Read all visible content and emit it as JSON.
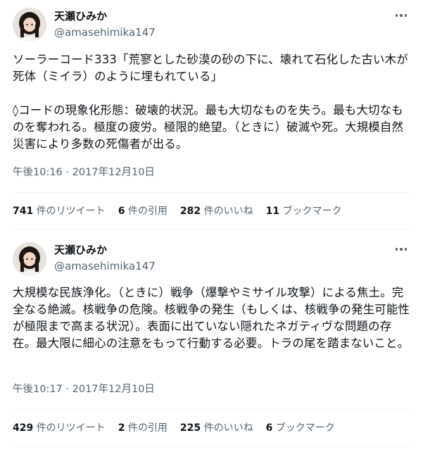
{
  "tweets": [
    {
      "author": {
        "name": "天瀬ひみか",
        "handle": "@amasehimika147"
      },
      "text": "ソーラーコード333「荒寥とした砂漠の砂の下に、壊れて石化した古い木が死体（ミイラ）のように埋もれている」\n\n◊コードの現象化形態：破壊的状況。最も大切なものを失う。最も大切なものを奪われる。極度の疲労。極限的絶望。（ときに）破滅や死。大規模自然災害により多数の死傷者が出る。",
      "timestamp": "午後10:16 · 2017年12月10日",
      "stats": {
        "retweets": {
          "count": "741",
          "label": "件のリツイート"
        },
        "quotes": {
          "count": "6",
          "label": "件の引用"
        },
        "likes": {
          "count": "282",
          "label": "件のいいね"
        },
        "bookmarks": {
          "count": "11",
          "label": "ブックマーク"
        }
      }
    },
    {
      "author": {
        "name": "天瀬ひみか",
        "handle": "@amasehimika147"
      },
      "text": "大規模な民族浄化。（ときに）戦争（爆撃やミサイル攻撃）による焦土。完全なる絶滅。核戦争の危険。核戦争の発生（もしくは、核戦争の発生可能性が極限まで高まる状況）。表面に出ていない隠れたネガティヴな問題の存在。最大限に細心の注意をもって行動する必要。トラの尾を踏まないこと。",
      "timestamp": "午後10:17 · 2017年12月10日",
      "stats": {
        "retweets": {
          "count": "429",
          "label": "件のリツイート"
        },
        "quotes": {
          "count": "2",
          "label": "件の引用"
        },
        "likes": {
          "count": "225",
          "label": "件のいいね"
        },
        "bookmarks": {
          "count": "6",
          "label": "ブックマーク"
        }
      }
    }
  ]
}
